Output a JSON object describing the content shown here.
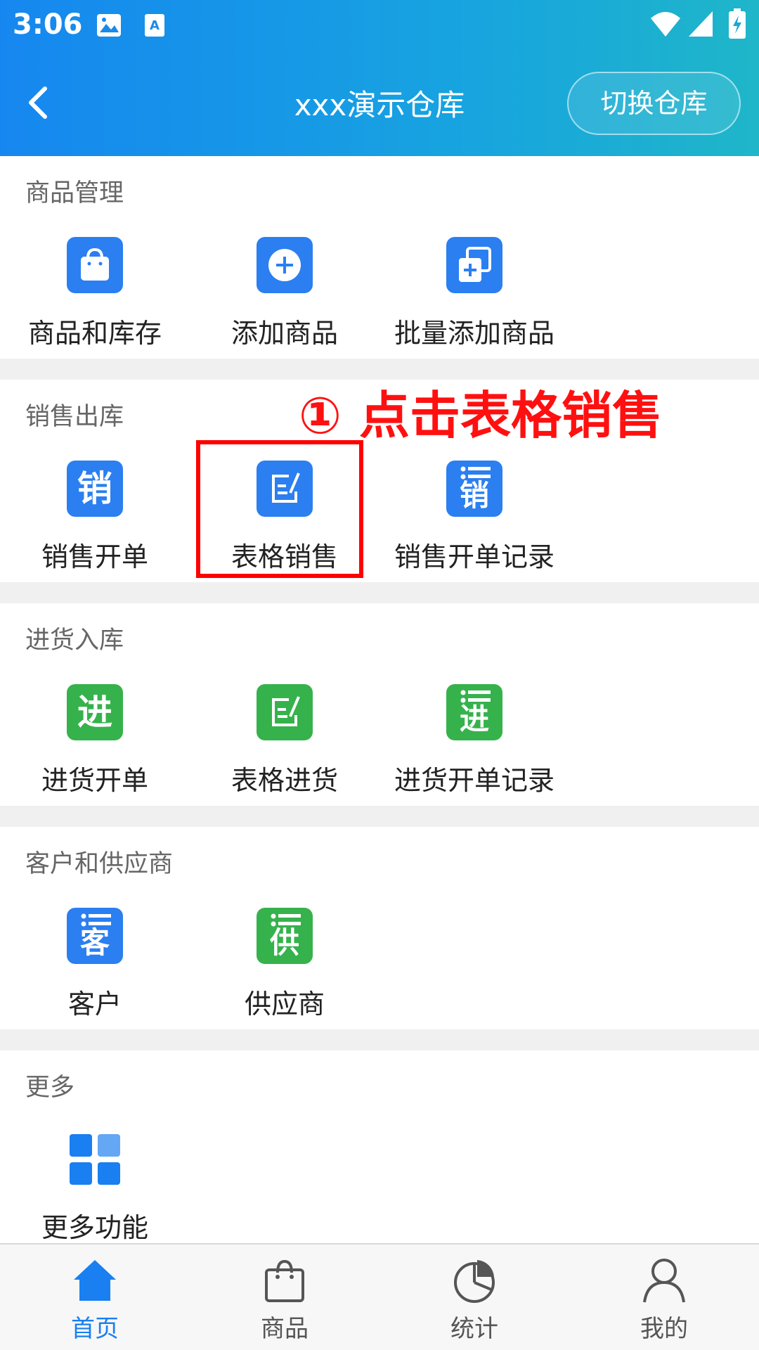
{
  "status_bar": {
    "time": "3:06"
  },
  "nav": {
    "title": "xxx演示仓库",
    "switch_label": "切换仓库"
  },
  "colors": {
    "header_start": "#1687f0",
    "header_end": "#1fb6c9",
    "blue": "#2b7ff0",
    "green": "#36b24c",
    "annotation": "#ff0000",
    "active_tab": "#1a7ff0"
  },
  "sections": [
    {
      "title": "商品管理",
      "items": [
        {
          "label": "商品和库存",
          "icon": "shopping-bag-icon"
        },
        {
          "label": "添加商品",
          "icon": "add-circle-icon"
        },
        {
          "label": "批量添加商品",
          "icon": "batch-add-icon"
        }
      ]
    },
    {
      "title": "销售出库",
      "items": [
        {
          "label": "销售开单",
          "icon": "sale-icon",
          "glyph": "销"
        },
        {
          "label": "表格销售",
          "icon": "form-edit-icon"
        },
        {
          "label": "销售开单记录",
          "icon": "sale-record-icon",
          "glyph": "销"
        }
      ]
    },
    {
      "title": "进货入库",
      "items": [
        {
          "label": "进货开单",
          "icon": "purchase-icon",
          "glyph": "进"
        },
        {
          "label": "表格进货",
          "icon": "form-edit-icon"
        },
        {
          "label": "进货开单记录",
          "icon": "purchase-record-icon",
          "glyph": "进"
        }
      ]
    },
    {
      "title": "客户和供应商",
      "items": [
        {
          "label": "客户",
          "icon": "customer-icon",
          "glyph": "客"
        },
        {
          "label": "供应商",
          "icon": "supplier-icon",
          "glyph": "供"
        }
      ]
    },
    {
      "title": "更多",
      "items": [
        {
          "label": "更多功能",
          "icon": "grid-icon"
        }
      ]
    }
  ],
  "annotation": {
    "text": "① 点击表格销售"
  },
  "tabs": [
    {
      "label": "首页",
      "icon": "home-icon",
      "active": true
    },
    {
      "label": "商品",
      "icon": "bag-icon",
      "active": false
    },
    {
      "label": "统计",
      "icon": "pie-chart-icon",
      "active": false
    },
    {
      "label": "我的",
      "icon": "user-icon",
      "active": false
    }
  ]
}
